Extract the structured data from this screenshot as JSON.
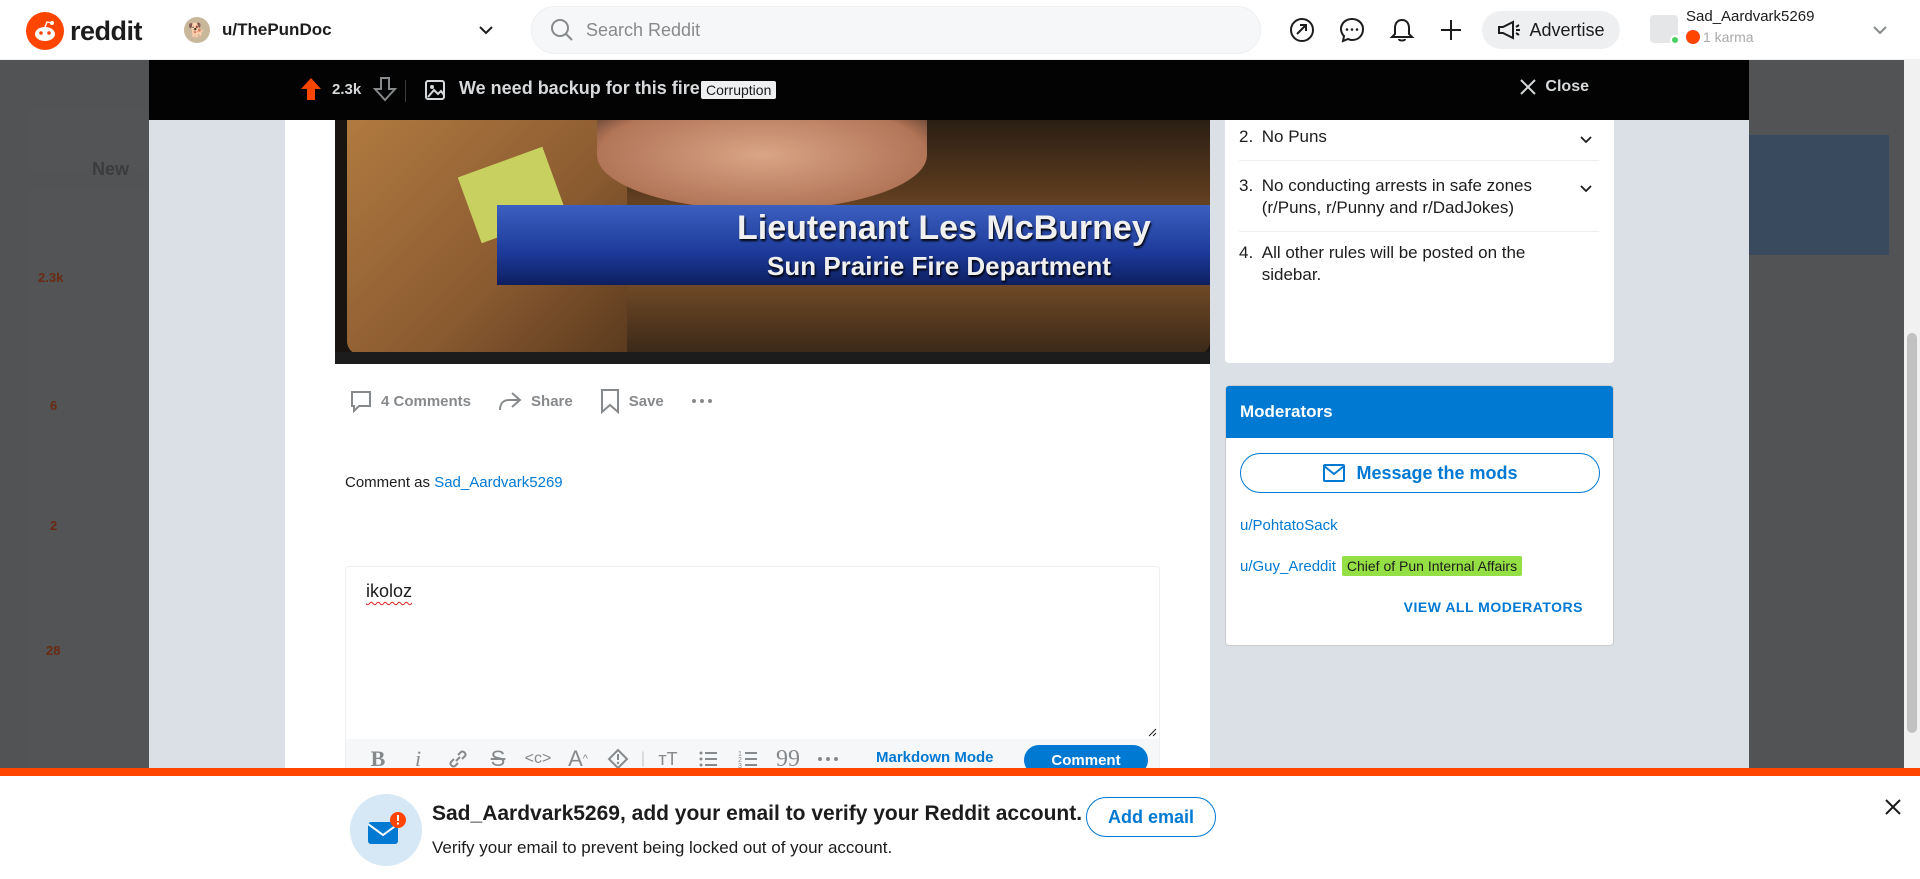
{
  "header": {
    "logo_text": "reddit",
    "community": "u/ThePunDoc",
    "search_placeholder": "Search Reddit",
    "advertise_label": "Advertise",
    "username": "Sad_Aardvark5269",
    "karma": "1 karma"
  },
  "background_feed": {
    "sort_label": "New",
    "vote_counts": [
      "2.3k",
      "6",
      "2",
      "28"
    ]
  },
  "post_bar": {
    "score": "2.3k",
    "title": "We need backup for this fire!",
    "flair": "Corruption",
    "close_label": "Close"
  },
  "image": {
    "caption_line1": "Lieutenant Les McBurney",
    "caption_line2": "Sun Prairie Fire Department"
  },
  "actions": {
    "comments": "4 Comments",
    "share": "Share",
    "save": "Save"
  },
  "comment_form": {
    "comment_as_prefix": "Comment as",
    "username": "Sad_Aardvark5269",
    "draft_text": "ikoloz",
    "markdown_mode": "Markdown Mode",
    "submit": "Comment"
  },
  "rules": [
    {
      "num": "2.",
      "text": "No Puns",
      "expandable": true
    },
    {
      "num": "3.",
      "text": "No conducting arrests in safe zones (r/Puns, r/Punny and r/DadJokes)",
      "expandable": true
    },
    {
      "num": "4.",
      "text": "All other rules will be posted on the sidebar.",
      "expandable": false
    }
  ],
  "moderators": {
    "heading": "Moderators",
    "message_label": "Message the mods",
    "list": [
      {
        "name": "u/PohtatoSack",
        "flair": ""
      },
      {
        "name": "u/Guy_Areddit",
        "flair": "Chief of Pun Internal Affairs"
      }
    ],
    "view_all": "VIEW ALL MODERATORS"
  },
  "banner": {
    "title": "Sad_Aardvark5269, add your email to verify your Reddit account.",
    "subtitle": "Verify your email to prevent being locked out of your account.",
    "button": "Add email"
  },
  "colors": {
    "brand": "#ff4500",
    "link": "#0079d3",
    "mod_flair": "#94e044"
  }
}
